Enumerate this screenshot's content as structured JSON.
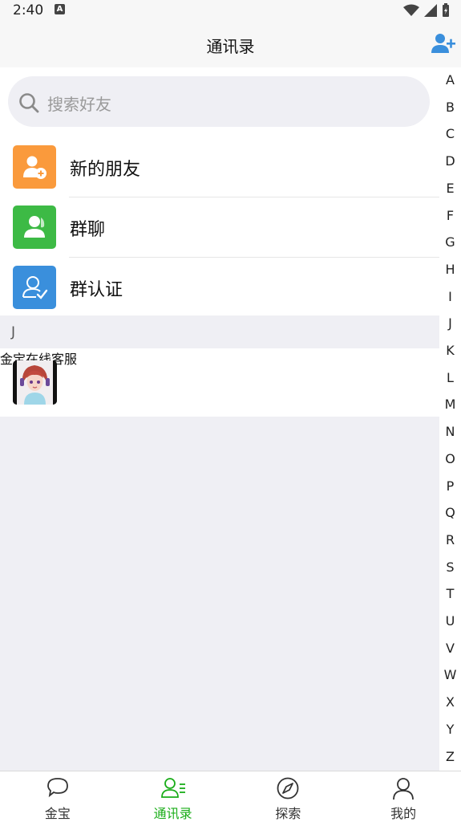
{
  "status_bar": {
    "time": "2:40",
    "notification_glyph": "A"
  },
  "nav": {
    "title": "通讯录",
    "add_friend_icon": "add-user-icon"
  },
  "search": {
    "placeholder": "搜索好友"
  },
  "menu_items": [
    {
      "label": "新的朋友",
      "icon": "new-friend-icon",
      "color": "#fa9a3c"
    },
    {
      "label": "群聊",
      "icon": "group-chat-icon",
      "color": "#3dba45"
    },
    {
      "label": "群认证",
      "icon": "group-verify-icon",
      "color": "#3a8fdc"
    }
  ],
  "section": {
    "letter": "J"
  },
  "contacts": [
    {
      "name": "金宝在线客服",
      "avatar": "avatar-girl"
    }
  ],
  "index_letters": [
    "A",
    "B",
    "C",
    "D",
    "E",
    "F",
    "G",
    "H",
    "I",
    "J",
    "K",
    "L",
    "M",
    "N",
    "O",
    "P",
    "Q",
    "R",
    "S",
    "T",
    "U",
    "V",
    "W",
    "X",
    "Y",
    "Z"
  ],
  "tabs": [
    {
      "label": "金宝",
      "icon": "chat-bubble-icon",
      "active": false
    },
    {
      "label": "通讯录",
      "icon": "contacts-icon",
      "active": true
    },
    {
      "label": "探索",
      "icon": "compass-icon",
      "active": false
    },
    {
      "label": "我的",
      "icon": "profile-icon",
      "active": false
    }
  ],
  "colors": {
    "accent_green": "#1aad19",
    "blue_icon": "#3a8fdc"
  }
}
